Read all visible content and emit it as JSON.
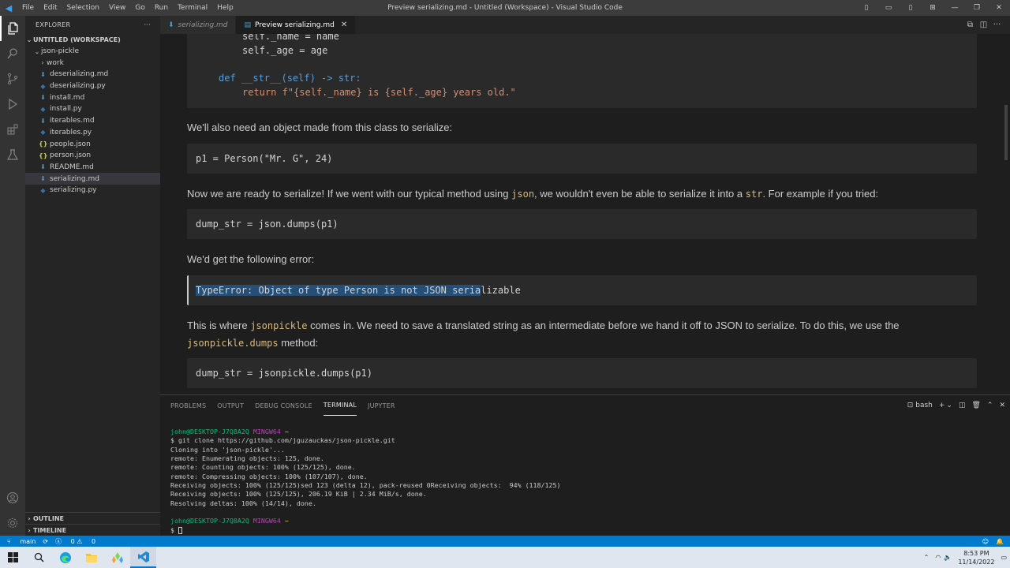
{
  "titlebar": {
    "logo": "◀",
    "menu": [
      "File",
      "Edit",
      "Selection",
      "View",
      "Go",
      "Run",
      "Terminal",
      "Help"
    ],
    "title": "Preview serializing.md - Untitled (Workspace) - Visual Studio Code"
  },
  "activity": [
    "files-icon",
    "search-icon",
    "source-control-icon",
    "run-debug-icon",
    "extensions-icon",
    "testing-icon"
  ],
  "sidebar": {
    "header": "EXPLORER",
    "workspace": "UNTITLED (WORKSPACE)",
    "folder": "json-pickle",
    "subfolder": "work",
    "files": [
      {
        "name": "deserializing.md",
        "type": "md"
      },
      {
        "name": "deserializing.py",
        "type": "py"
      },
      {
        "name": "install.md",
        "type": "md"
      },
      {
        "name": "install.py",
        "type": "py"
      },
      {
        "name": "iterables.md",
        "type": "md"
      },
      {
        "name": "iterables.py",
        "type": "py"
      },
      {
        "name": "people.json",
        "type": "json"
      },
      {
        "name": "person.json",
        "type": "json"
      },
      {
        "name": "README.md",
        "type": "md"
      },
      {
        "name": "serializing.md",
        "type": "md",
        "selected": true
      },
      {
        "name": "serializing.py",
        "type": "py"
      }
    ],
    "outline": "OUTLINE",
    "timeline": "TIMELINE"
  },
  "tabs": [
    {
      "label": "serializing.md",
      "active": false
    },
    {
      "label": "Preview serializing.md",
      "active": true
    }
  ],
  "preview": {
    "code1": [
      "self._name = name",
      "self._age = age",
      "def __str__(self) -> str:",
      "return f\"{self._name} is {self._age} years old.\""
    ],
    "para1": "We'll also need an object made from this class to serialize:",
    "code2": "p1 = Person(\"Mr. G\", 24)",
    "para2_a": "Now we are ready to serialize! If we went with our typical method using ",
    "para2_code1": "json",
    "para2_b": ", we wouldn't even be able to serialize it into a ",
    "para2_code2": "str",
    "para2_c": ". For example if you tried:",
    "code3": "dump_str = json.dumps(p1)",
    "para3": "We'd get the following error:",
    "code4_selected": "TypeError: Object of type Person is not JSON seria",
    "code4_rest": "lizable",
    "para4_a": "This is where ",
    "para4_code1": "jsonpickle",
    "para4_b": " comes in. We need to save a translated string as an intermediate before we hand it off to JSON to serialize. To do this, we use the",
    "para4_code2": "jsonpickle.dumps",
    "para4_c": " method:",
    "code5": "dump_str = jsonpickle.dumps(p1)"
  },
  "panel": {
    "tabs": [
      "PROBLEMS",
      "OUTPUT",
      "DEBUG CONSOLE",
      "TERMINAL",
      "JUPYTER"
    ],
    "active_tab": "TERMINAL",
    "shell": "bash",
    "prompt_user": "john@DESKTOP-J7Q8A2Q",
    "prompt_env": "MINGW64",
    "prompt_dir": "~",
    "lines": [
      "$ git clone https://github.com/jguzauckas/json-pickle.git",
      "Cloning into 'json-pickle'...",
      "remote: Enumerating objects: 125, done.",
      "remote: Counting objects: 100% (125/125), done.",
      "remote: Compressing objects: 100% (107/107), done.",
      "Receiving objects: 100% (125/125)sed 123 (delta 12), pack-reused 0Receiving objects:  94% (118/125)",
      "Receiving objects: 100% (125/125), 206.19 KiB | 2.34 MiB/s, done.",
      "Resolving deltas: 100% (14/14), done."
    ],
    "last_prompt": "$ "
  },
  "statusbar": {
    "branch": "main",
    "errors": "0",
    "warnings": "0"
  },
  "taskbar": {
    "time": "8:53 PM",
    "date": "11/14/2022"
  },
  "colors": {
    "accent": "#007acc",
    "editor_bg": "#1e1e1e",
    "sidebar_bg": "#252526",
    "selection": "#264f78"
  }
}
